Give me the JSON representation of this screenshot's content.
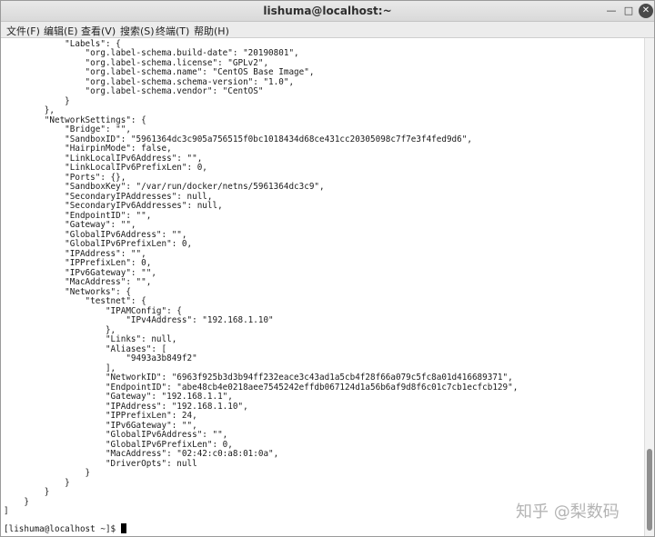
{
  "window": {
    "title": "lishuma@localhost:~",
    "controls": {
      "minimize": "—",
      "maximize": "□",
      "close": "✕"
    }
  },
  "menu": [
    "文件(F)",
    "编辑(E)",
    "查看(V)",
    "搜索(S)",
    "终端(T)",
    "帮助(H)"
  ],
  "terminal": {
    "lines": [
      "            \"Labels\": {",
      "                \"org.label-schema.build-date\": \"20190801\",",
      "                \"org.label-schema.license\": \"GPLv2\",",
      "                \"org.label-schema.name\": \"CentOS Base Image\",",
      "                \"org.label-schema.schema-version\": \"1.0\",",
      "                \"org.label-schema.vendor\": \"CentOS\"",
      "            }",
      "        },",
      "        \"NetworkSettings\": {",
      "            \"Bridge\": \"\",",
      "            \"SandboxID\": \"5961364dc3c905a756515f0bc1018434d68ce431cc20305098c7f7e3f4fed9d6\",",
      "            \"HairpinMode\": false,",
      "            \"LinkLocalIPv6Address\": \"\",",
      "            \"LinkLocalIPv6PrefixLen\": 0,",
      "            \"Ports\": {},",
      "            \"SandboxKey\": \"/var/run/docker/netns/5961364dc3c9\",",
      "            \"SecondaryIPAddresses\": null,",
      "            \"SecondaryIPv6Addresses\": null,",
      "            \"EndpointID\": \"\",",
      "            \"Gateway\": \"\",",
      "            \"GlobalIPv6Address\": \"\",",
      "            \"GlobalIPv6PrefixLen\": 0,",
      "            \"IPAddress\": \"\",",
      "            \"IPPrefixLen\": 0,",
      "            \"IPv6Gateway\": \"\",",
      "            \"MacAddress\": \"\",",
      "            \"Networks\": {",
      "                \"testnet\": {",
      "                    \"IPAMConfig\": {",
      "                        \"IPv4Address\": \"192.168.1.10\"",
      "                    },",
      "                    \"Links\": null,",
      "                    \"Aliases\": [",
      "                        \"9493a3b849f2\"",
      "                    ],",
      "                    \"NetworkID\": \"6963f925b3d3b94ff232eace3c43ad1a5cb4f28f66a079c5fc8a01d416689371\",",
      "                    \"EndpointID\": \"abe48cb4e0218aee7545242effdb067124d1a56b6af9d8f6c01c7cb1ecfcb129\",",
      "                    \"Gateway\": \"192.168.1.1\",",
      "                    \"IPAddress\": \"192.168.1.10\",",
      "                    \"IPPrefixLen\": 24,",
      "                    \"IPv6Gateway\": \"\",",
      "                    \"GlobalIPv6Address\": \"\",",
      "                    \"GlobalIPv6PrefixLen\": 0,",
      "                    \"MacAddress\": \"02:42:c0:a8:01:0a\",",
      "                    \"DriverOpts\": null",
      "                }",
      "            }",
      "        }",
      "    }",
      "]"
    ],
    "prompt": "[lishuma@localhost ~]$ "
  },
  "watermark": "知乎 @梨数码"
}
